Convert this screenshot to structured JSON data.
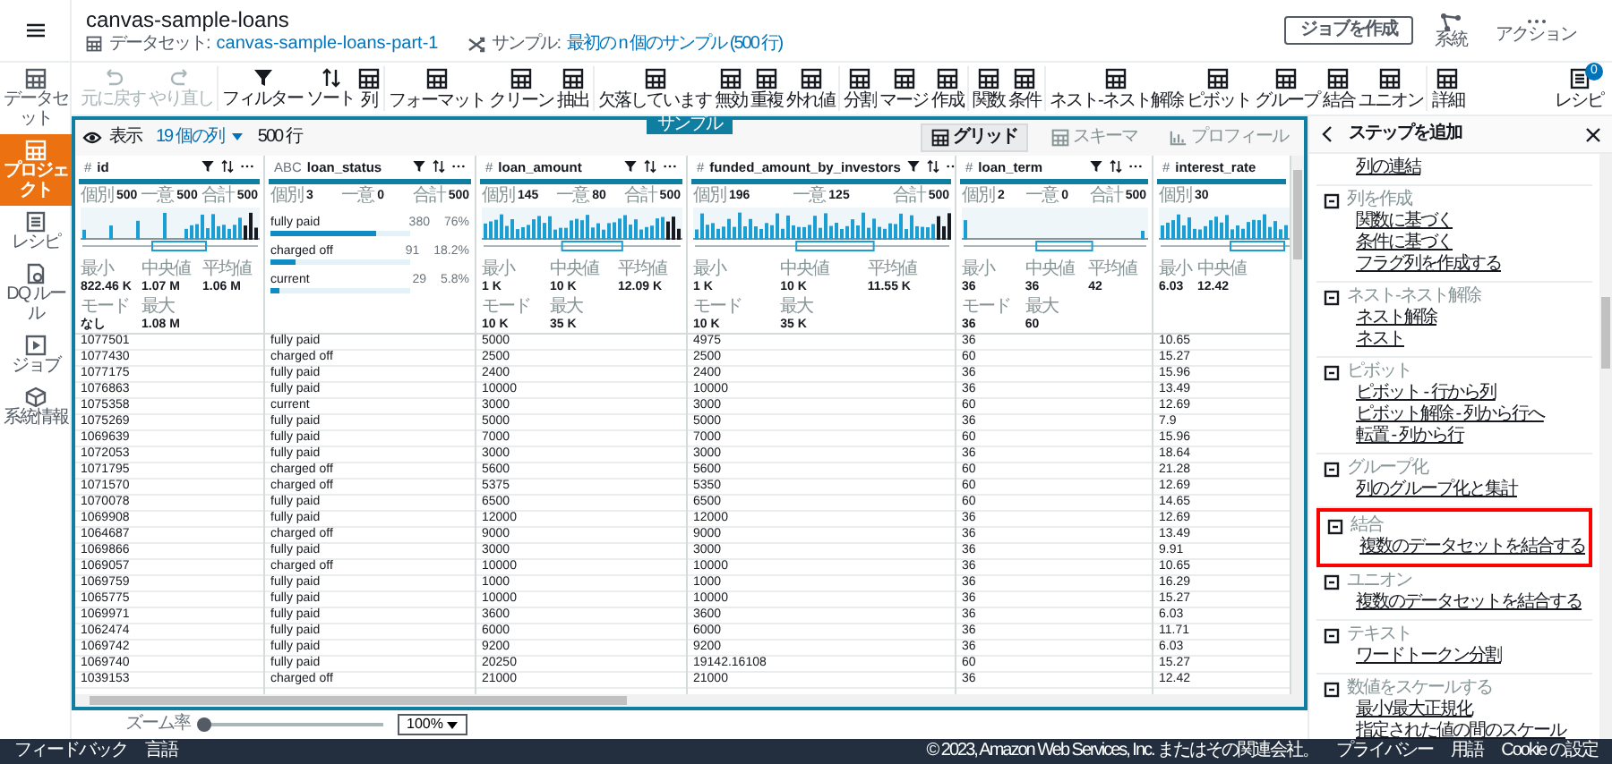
{
  "header": {
    "title": "canvas-sample-loans",
    "dataset_label": "データセット:",
    "dataset": "canvas-sample-loans-part-1",
    "sample_label": "サンプル:",
    "sample": "最初の n 個のサンプル (500 行)",
    "create_job": "ジョブを作成",
    "actions": [
      "系統",
      "アクション"
    ]
  },
  "sidebar": [
    {
      "label": "データセット",
      "selected": false
    },
    {
      "label": "プロジェクト",
      "selected": true
    },
    {
      "label": "レシピ",
      "selected": false
    },
    {
      "label": "DQ ルール",
      "selected": false
    },
    {
      "label": "ジョブ",
      "selected": false
    },
    {
      "label": "系統情報",
      "selected": false
    }
  ],
  "toolbar": {
    "tools": [
      {
        "label": "元に戻す",
        "disabled": true
      },
      {
        "label": "やり直し",
        "disabled": true
      },
      {
        "label": "フィルター",
        "disabled": false
      },
      {
        "label": "ソート",
        "disabled": false
      },
      {
        "label": "列",
        "disabled": false
      },
      {
        "label": "フォーマット",
        "disabled": false
      },
      {
        "label": "クリーン",
        "disabled": false
      },
      {
        "label": "抽出",
        "disabled": false
      },
      {
        "label": "欠落しています",
        "disabled": false
      },
      {
        "label": "無効",
        "disabled": false
      },
      {
        "label": "重複",
        "disabled": false
      },
      {
        "label": "外れ値",
        "disabled": false
      },
      {
        "label": "分割",
        "disabled": false
      },
      {
        "label": "マージ",
        "disabled": false
      },
      {
        "label": "作成",
        "disabled": false
      },
      {
        "label": "関数",
        "disabled": false
      },
      {
        "label": "条件",
        "disabled": false
      },
      {
        "label": "ネスト-ネスト解除",
        "disabled": false
      },
      {
        "label": "ピボット",
        "disabled": false
      },
      {
        "label": "グループ",
        "disabled": false
      },
      {
        "label": "結合",
        "disabled": false
      },
      {
        "label": "ユニオン",
        "disabled": false
      },
      {
        "label": "詳細",
        "disabled": false
      }
    ],
    "recipe": {
      "label": "レシピ",
      "badge": "0"
    }
  },
  "view": {
    "show": "表示",
    "columns": "19 個の列",
    "rows": "500 行",
    "sample_tab": "サンプル",
    "modes": [
      {
        "label": "グリッド",
        "selected": true
      },
      {
        "label": "スキーマ",
        "selected": false
      },
      {
        "label": "プロフィール",
        "selected": false
      }
    ]
  },
  "columns": [
    {
      "type": "#",
      "name": "id",
      "kind": "numeric",
      "counts": [
        {
          "label": "個別",
          "value": "500"
        },
        {
          "label": "一意",
          "value": "500"
        },
        {
          "label": "合計",
          "value": "500"
        }
      ],
      "stats": [
        {
          "label": "最小",
          "value": "822.46 K"
        },
        {
          "label": "中央値",
          "value": "1.07 M"
        },
        {
          "label": "平均値",
          "value": "1.06 M"
        },
        {
          "label": "モード",
          "value": "なし"
        },
        {
          "label": "最大",
          "value": "1.08 M"
        }
      ]
    },
    {
      "type": "ABC",
      "name": "loan_status",
      "kind": "categorical",
      "counts": [
        {
          "label": "個別",
          "value": "3"
        },
        {
          "label": "一意",
          "value": "0"
        },
        {
          "label": "合計",
          "value": "500"
        }
      ],
      "categories": [
        {
          "label": "fully paid",
          "count": "380",
          "percent": "76%",
          "level": 0.76
        },
        {
          "label": "charged off",
          "count": "91",
          "percent": "18.2%",
          "level": 0.182
        },
        {
          "label": "current",
          "count": "29",
          "percent": "5.8%",
          "level": 0.058
        }
      ]
    },
    {
      "type": "#",
      "name": "loan_amount",
      "kind": "numeric",
      "counts": [
        {
          "label": "個別",
          "value": "145"
        },
        {
          "label": "一意",
          "value": "80"
        },
        {
          "label": "合計",
          "value": "500"
        }
      ],
      "stats": [
        {
          "label": "最小",
          "value": "1 K"
        },
        {
          "label": "中央値",
          "value": "10 K"
        },
        {
          "label": "平均値",
          "value": "12.09 K"
        },
        {
          "label": "モード",
          "value": "10 K"
        },
        {
          "label": "最大",
          "value": "35 K"
        }
      ]
    },
    {
      "type": "#",
      "name": "funded_amount_by_investors",
      "kind": "numeric",
      "counts": [
        {
          "label": "個別",
          "value": "196"
        },
        {
          "label": "一意",
          "value": "125"
        },
        {
          "label": "合計",
          "value": "500"
        }
      ],
      "stats": [
        {
          "label": "最小",
          "value": "1 K"
        },
        {
          "label": "中央値",
          "value": "10 K"
        },
        {
          "label": "平均値",
          "value": "11.55 K"
        },
        {
          "label": "モード",
          "value": "10 K"
        },
        {
          "label": "最大",
          "value": "35 K"
        }
      ]
    },
    {
      "type": "#",
      "name": "loan_term",
      "kind": "numeric",
      "counts": [
        {
          "label": "個別",
          "value": "2"
        },
        {
          "label": "一意",
          "value": "0"
        },
        {
          "label": "合計",
          "value": "500"
        }
      ],
      "stats": [
        {
          "label": "最小",
          "value": "36"
        },
        {
          "label": "中央値",
          "value": "36"
        },
        {
          "label": "平均値",
          "value": "42"
        },
        {
          "label": "モード",
          "value": "36"
        },
        {
          "label": "最大",
          "value": "60"
        }
      ]
    },
    {
      "type": "#",
      "name": "interest_rate",
      "kind": "numeric",
      "counts": [
        {
          "label": "個別",
          "value": "30"
        }
      ],
      "stats": [
        {
          "label": "最小",
          "value": "6.03"
        },
        {
          "label": "中央値",
          "value": "12.42"
        }
      ]
    }
  ],
  "rows": [
    [
      "1077501",
      "fully paid",
      "5000",
      "4975",
      "36",
      "10.65"
    ],
    [
      "1077430",
      "charged off",
      "2500",
      "2500",
      "60",
      "15.27"
    ],
    [
      "1077175",
      "fully paid",
      "2400",
      "2400",
      "36",
      "15.96"
    ],
    [
      "1076863",
      "fully paid",
      "10000",
      "10000",
      "36",
      "13.49"
    ],
    [
      "1075358",
      "current",
      "3000",
      "3000",
      "60",
      "12.69"
    ],
    [
      "1075269",
      "fully paid",
      "5000",
      "5000",
      "36",
      "7.9"
    ],
    [
      "1069639",
      "fully paid",
      "7000",
      "7000",
      "60",
      "15.96"
    ],
    [
      "1072053",
      "fully paid",
      "3000",
      "3000",
      "36",
      "18.64"
    ],
    [
      "1071795",
      "charged off",
      "5600",
      "5600",
      "60",
      "21.28"
    ],
    [
      "1071570",
      "charged off",
      "5375",
      "5350",
      "60",
      "12.69"
    ],
    [
      "1070078",
      "fully paid",
      "6500",
      "6500",
      "60",
      "14.65"
    ],
    [
      "1069908",
      "fully paid",
      "12000",
      "12000",
      "36",
      "12.69"
    ],
    [
      "1064687",
      "charged off",
      "9000",
      "9000",
      "36",
      "13.49"
    ],
    [
      "1069866",
      "fully paid",
      "3000",
      "3000",
      "36",
      "9.91"
    ],
    [
      "1069057",
      "charged off",
      "10000",
      "10000",
      "36",
      "10.65"
    ],
    [
      "1069759",
      "fully paid",
      "1000",
      "1000",
      "36",
      "16.29"
    ],
    [
      "1065775",
      "fully paid",
      "10000",
      "10000",
      "36",
      "15.27"
    ],
    [
      "1069971",
      "fully paid",
      "3600",
      "3600",
      "36",
      "6.03"
    ],
    [
      "1062474",
      "fully paid",
      "6000",
      "6000",
      "36",
      "11.71"
    ],
    [
      "1069742",
      "fully paid",
      "9200",
      "9200",
      "36",
      "6.03"
    ],
    [
      "1069740",
      "fully paid",
      "20250",
      "19142.16108",
      "60",
      "15.27"
    ],
    [
      "1039153",
      "charged off",
      "21000",
      "21000",
      "36",
      "12.42"
    ]
  ],
  "zoom": {
    "label": "ズーム率",
    "level": 0,
    "value": "100%"
  },
  "panel": {
    "title": "ステップを追加",
    "groups": [
      {
        "items": [
          "列の連結"
        ],
        "highlighted": false
      },
      {
        "title": "列を作成",
        "items": [
          "関数に基づく",
          "条件に基づく",
          "フラグ列を作成する"
        ],
        "highlighted": false
      },
      {
        "title": "ネスト-ネスト解除",
        "items": [
          "ネスト解除",
          "ネスト"
        ],
        "highlighted": false
      },
      {
        "title": "ピボット",
        "items": [
          "ピボット - 行から列",
          "ピボット解除 - 列から行へ",
          "転置 - 列から行"
        ],
        "highlighted": false
      },
      {
        "title": "グループ化",
        "items": [
          "列のグループ化と集計"
        ],
        "highlighted": false
      },
      {
        "title": "結合",
        "items": [
          "複数のデータセットを結合する"
        ],
        "highlighted": true
      },
      {
        "title": "ユニオン",
        "items": [
          "複数のデータセットを結合する"
        ],
        "highlighted": false
      },
      {
        "title": "テキスト",
        "items": [
          "ワードトークン分割"
        ],
        "highlighted": false
      },
      {
        "title": "数値をスケールする",
        "items": [
          "最小/最大正規化",
          "指定された値の間のスケール"
        ],
        "highlighted": false
      }
    ]
  },
  "footer": {
    "left": [
      "フィードバック",
      "言語"
    ],
    "right": [
      "© 2023, Amazon Web Services, Inc. またはその関連会社。",
      "プライバシー",
      "用語",
      "Cookie の設定"
    ]
  }
}
